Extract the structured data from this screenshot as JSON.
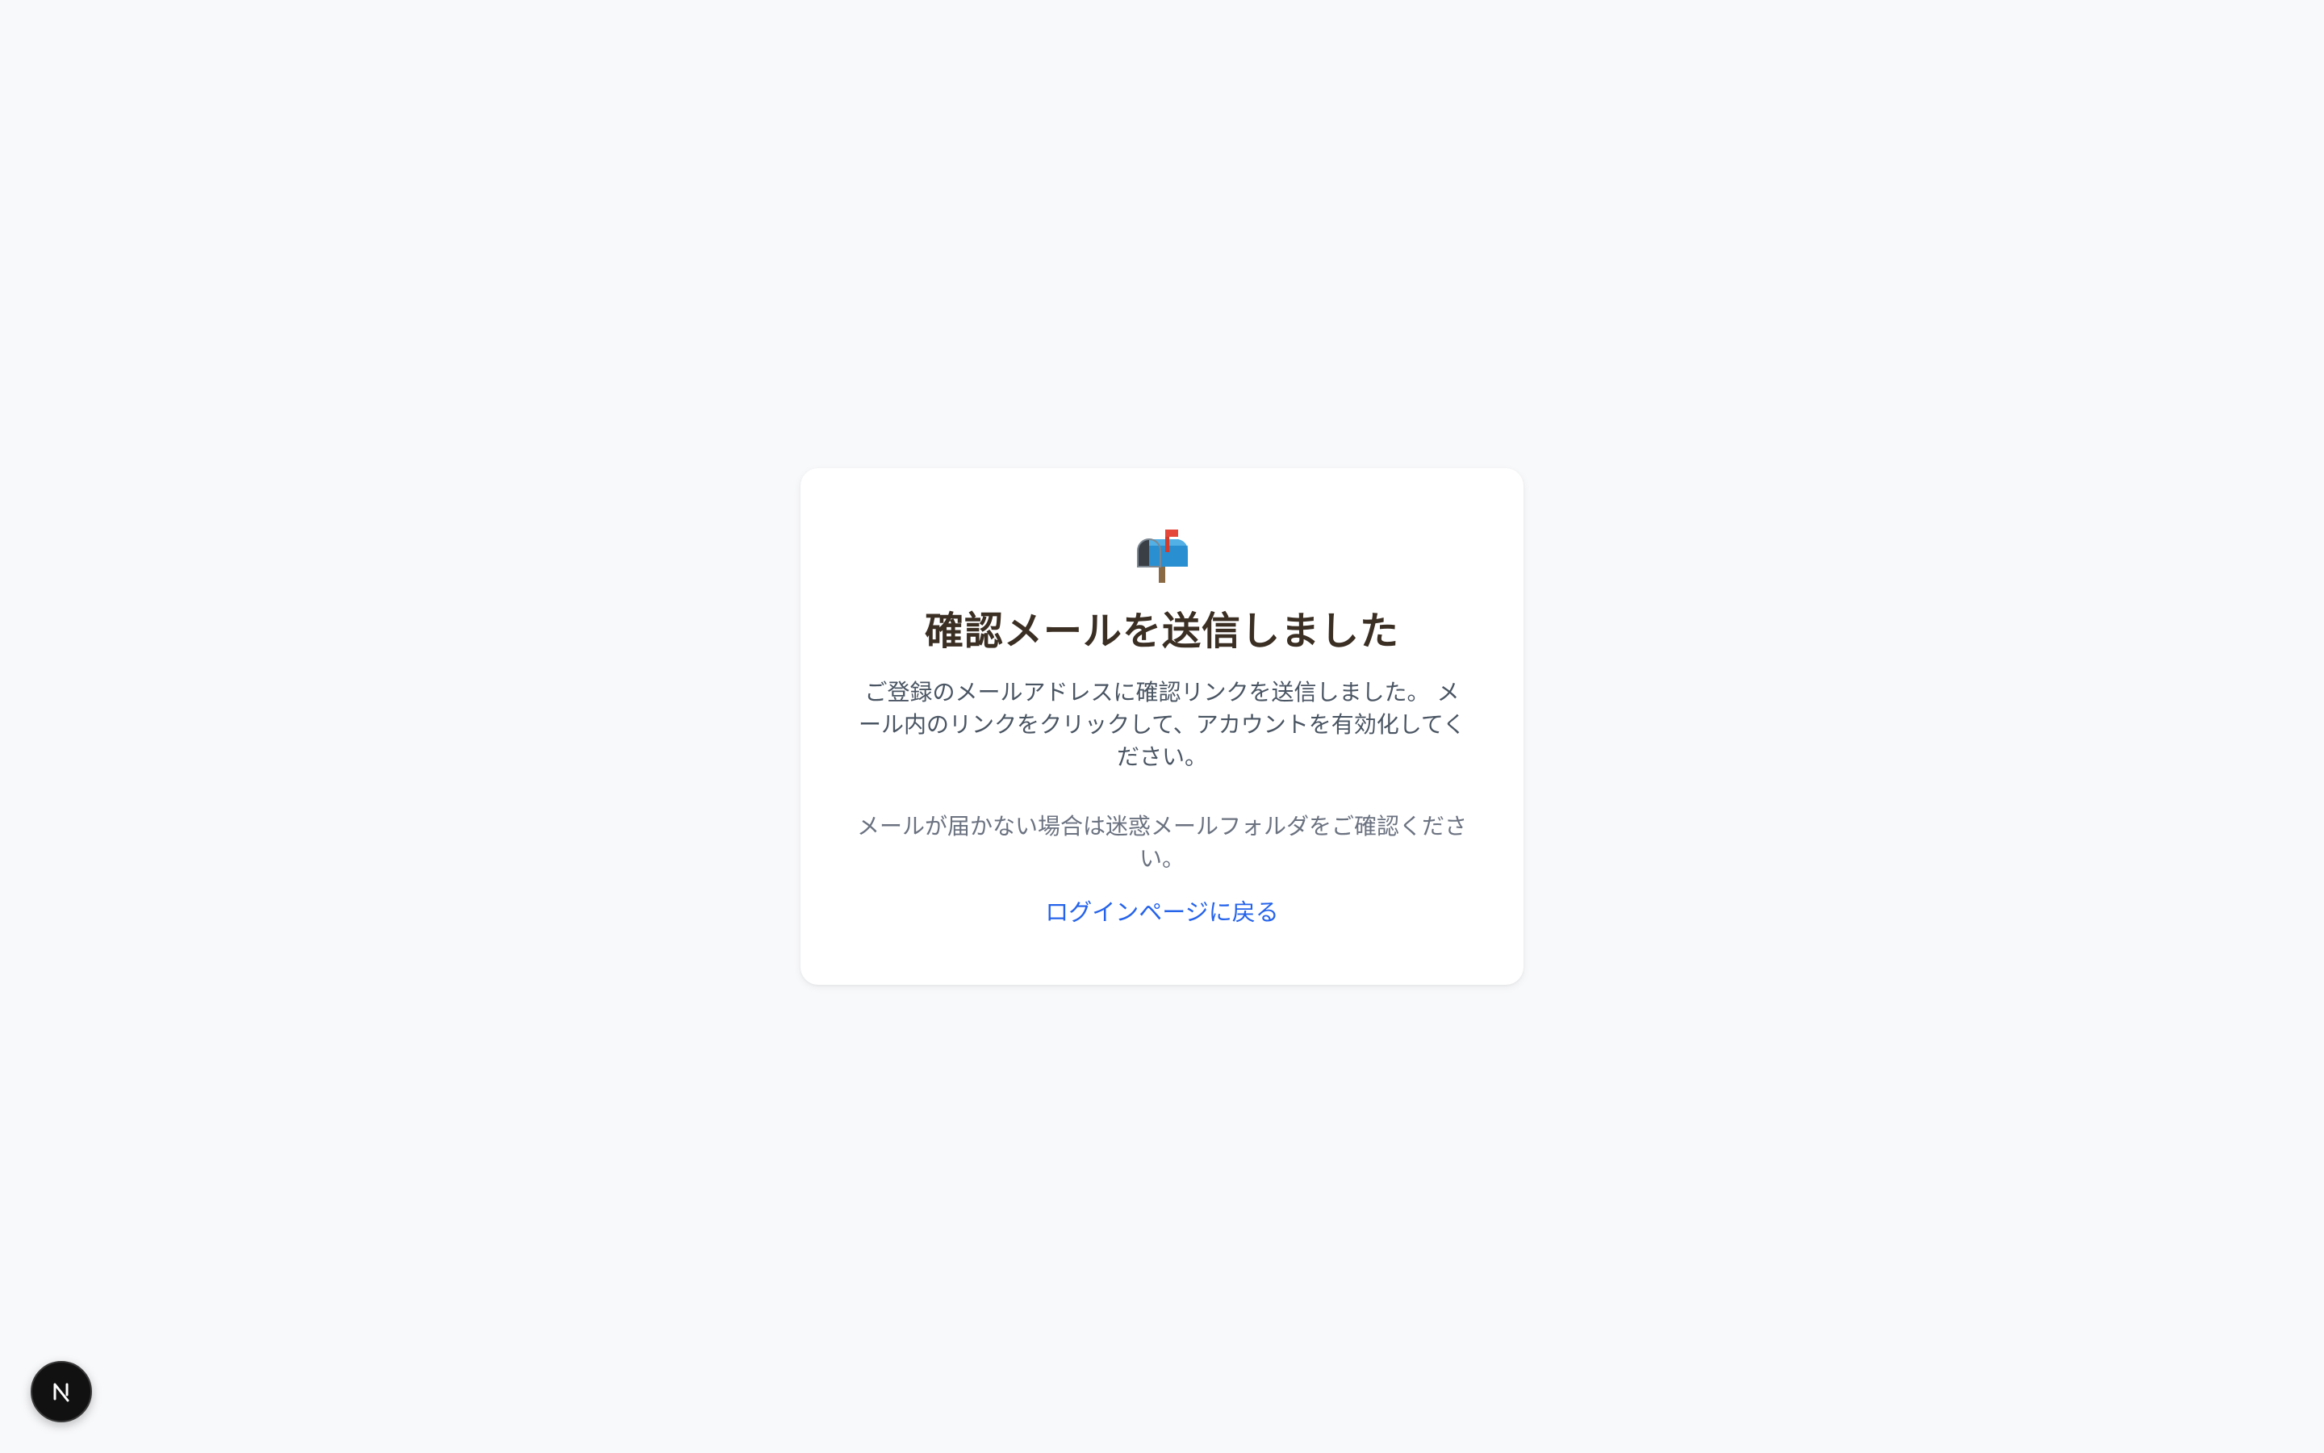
{
  "card": {
    "icon": "mailbox-with-raised-flag-icon",
    "title": "確認メールを送信しました",
    "description": "ご登録のメールアドレスに確認リンクを送信しました。 メール内のリンクをクリックして、アカウントを有効化してください。",
    "note": "メールが届かない場合は迷惑メールフォルダをご確認ください。",
    "back_link": "ログインページに戻る"
  },
  "dev_badge": {
    "icon": "nextjs-logo-icon"
  },
  "colors": {
    "background": "#f8f9fb",
    "title": "#3b2f24",
    "link": "#2563eb"
  }
}
